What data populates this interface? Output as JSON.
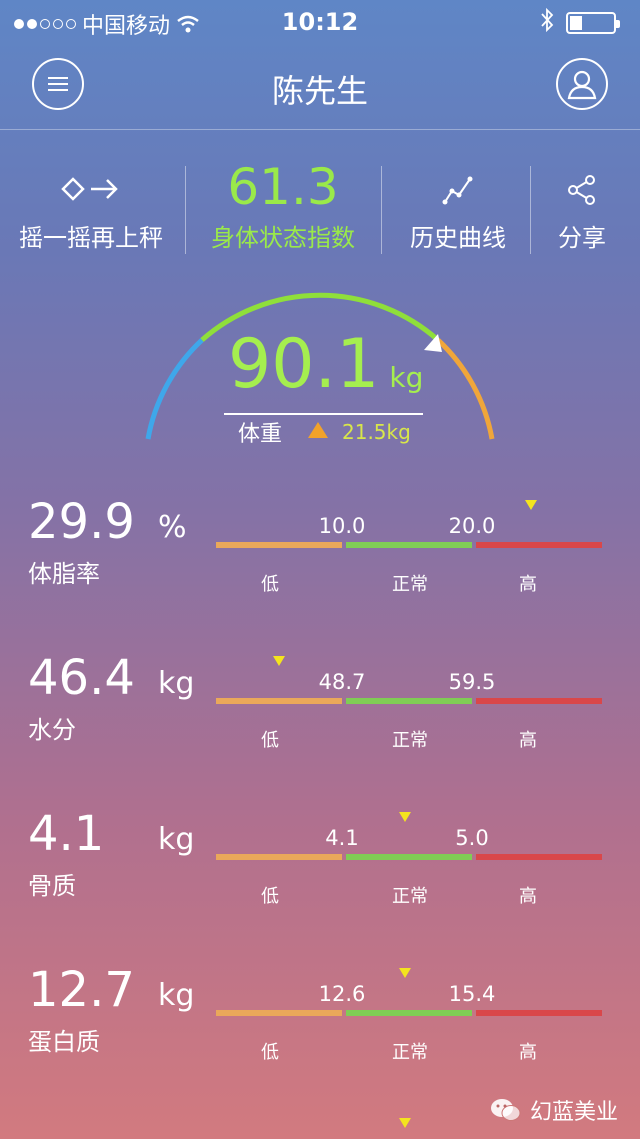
{
  "status_bar": {
    "carrier": "中国移动",
    "time": "10:12"
  },
  "header": {
    "title": "陈先生"
  },
  "actions": {
    "reweigh_label": "摇一摇再上秤",
    "body_score": "61.3",
    "body_score_label": "身体状态指数",
    "history_label": "历史曲线",
    "share_label": "分享"
  },
  "weight": {
    "value": "90.1",
    "unit": "kg",
    "label": "体重",
    "change": "21.5kg"
  },
  "zone_labels": {
    "low": "低",
    "normal": "正常",
    "high": "高"
  },
  "metrics": [
    {
      "value": "29.9",
      "unit": "%",
      "name": "体脂率",
      "t1": "10.0",
      "t2": "20.0"
    },
    {
      "value": "46.4",
      "unit": "kg",
      "name": "水分",
      "t1": "48.7",
      "t2": "59.5"
    },
    {
      "value": "4.1",
      "unit": "kg",
      "name": "骨质",
      "t1": "4.1",
      "t2": "5.0"
    },
    {
      "value": "12.7",
      "unit": "kg",
      "name": "蛋白质",
      "t1": "12.6",
      "t2": "15.4"
    }
  ],
  "watermark": "幻蓝美业",
  "colors": {
    "accent_green": "#9ae94a",
    "low": "#eaa85a",
    "normal": "#80cd55",
    "high": "#d9474a",
    "marker": "#f4e41e"
  }
}
